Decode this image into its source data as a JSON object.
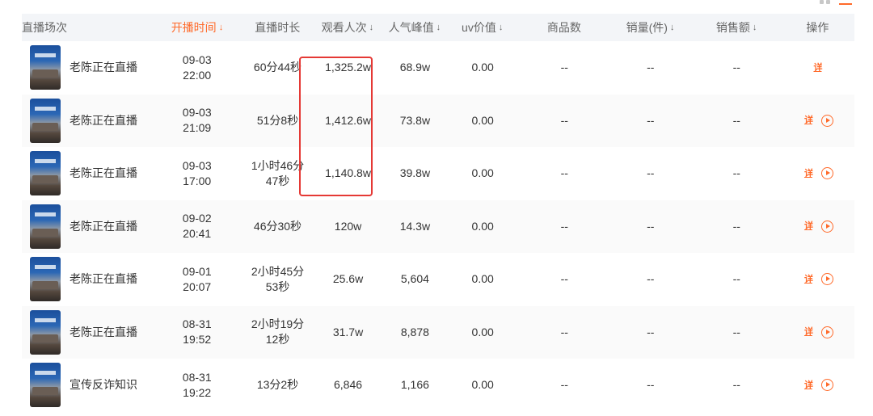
{
  "columns": [
    {
      "label": "直播场次",
      "sortable": false,
      "active": false
    },
    {
      "label": "开播时间",
      "sortable": true,
      "active": true
    },
    {
      "label": "直播时长",
      "sortable": false,
      "active": false
    },
    {
      "label": "观看人次",
      "sortable": true,
      "active": false
    },
    {
      "label": "人气峰值",
      "sortable": true,
      "active": false
    },
    {
      "label": "uv价值",
      "sortable": true,
      "active": false
    },
    {
      "label": "商品数",
      "sortable": false,
      "active": false
    },
    {
      "label": "销量(件)",
      "sortable": true,
      "active": false
    },
    {
      "label": "销售额",
      "sortable": true,
      "active": false
    },
    {
      "label": "操作",
      "sortable": false,
      "active": false
    }
  ],
  "sort_glyph": "↓",
  "detail_label": "详情",
  "rows": [
    {
      "name": "老陈正在直播",
      "date": "09-03",
      "time": "22:00",
      "duration": "60分44秒",
      "views": "1,325.2w",
      "peak": "68.9w",
      "uv": "0.00",
      "goods": "--",
      "sales": "--",
      "amount": "--",
      "has_play": false
    },
    {
      "name": "老陈正在直播",
      "date": "09-03",
      "time": "21:09",
      "duration": "51分8秒",
      "views": "1,412.6w",
      "peak": "73.8w",
      "uv": "0.00",
      "goods": "--",
      "sales": "--",
      "amount": "--",
      "has_play": true
    },
    {
      "name": "老陈正在直播",
      "date": "09-03",
      "time": "17:00",
      "duration": "1小时46分47秒",
      "views": "1,140.8w",
      "peak": "39.8w",
      "uv": "0.00",
      "goods": "--",
      "sales": "--",
      "amount": "--",
      "has_play": true
    },
    {
      "name": "老陈正在直播",
      "date": "09-02",
      "time": "20:41",
      "duration": "46分30秒",
      "views": "120w",
      "peak": "14.3w",
      "uv": "0.00",
      "goods": "--",
      "sales": "--",
      "amount": "--",
      "has_play": true
    },
    {
      "name": "老陈正在直播",
      "date": "09-01",
      "time": "20:07",
      "duration": "2小时45分53秒",
      "views": "25.6w",
      "peak": "5,604",
      "uv": "0.00",
      "goods": "--",
      "sales": "--",
      "amount": "--",
      "has_play": true
    },
    {
      "name": "老陈正在直播",
      "date": "08-31",
      "time": "19:52",
      "duration": "2小时19分12秒",
      "views": "31.7w",
      "peak": "8,878",
      "uv": "0.00",
      "goods": "--",
      "sales": "--",
      "amount": "--",
      "has_play": true
    },
    {
      "name": "宣传反诈知识",
      "date": "08-31",
      "time": "19:22",
      "duration": "13分2秒",
      "views": "6,846",
      "peak": "1,166",
      "uv": "0.00",
      "goods": "--",
      "sales": "--",
      "amount": "--",
      "has_play": true
    }
  ],
  "colors": {
    "accent": "#ff6a2a",
    "highlight": "#e53935",
    "header_bg": "#f3f5f8"
  }
}
